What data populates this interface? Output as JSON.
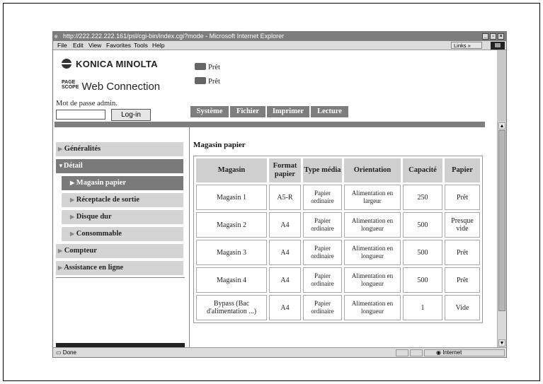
{
  "window": {
    "title": "http://222.222.222.161/psl/cgi-bin/index.cgi?mode - Microsoft Internet Explorer",
    "menu": [
      "File",
      "Edit",
      "View",
      "Favorites",
      "Tools",
      "Help"
    ],
    "links_label": "Links »",
    "status_text": "Done",
    "zone_text": "Internet"
  },
  "header": {
    "brand": "KONICA MINOLTA",
    "pagescope_small_1": "PAGE",
    "pagescope_small_2": "SCOPE",
    "pagescope_product": "Web Connection",
    "password_label": "Mot de passe admin.",
    "login_button": "Log-in",
    "status_1": "Prêt",
    "status_2": "Prêt"
  },
  "tabs": [
    "Système",
    "Fichier",
    "Imprimer",
    "Lecture"
  ],
  "sidebar": {
    "items": [
      {
        "label": "Généralités",
        "marker": "▶"
      },
      {
        "label": "Détail",
        "marker": "▼"
      },
      {
        "label": "Magasin papier",
        "marker": "▶"
      },
      {
        "label": "Réceptacle de sortie",
        "marker": "▶"
      },
      {
        "label": "Disque dur",
        "marker": "▶"
      },
      {
        "label": "Consommable",
        "marker": "▶"
      },
      {
        "label": "Compteur",
        "marker": "▶"
      },
      {
        "label": "Assistance en ligne",
        "marker": "▶"
      }
    ]
  },
  "main": {
    "title": "Magasin papier",
    "columns": [
      "Magasin",
      "Format papier",
      "Type média",
      "Orientation",
      "Capacité",
      "Papier"
    ],
    "rows": [
      [
        "Magasin 1",
        "A5-R",
        "Papier ordinaire",
        "Alimentation en largeur",
        "250",
        "Prêt"
      ],
      [
        "Magasin 2",
        "A4",
        "Papier ordinaire",
        "Alimentation en longueur",
        "500",
        "Presque vide"
      ],
      [
        "Magasin 3",
        "A4",
        "Papier ordinaire",
        "Alimentation en longueur",
        "500",
        "Prêt"
      ],
      [
        "Magasin 4",
        "A4",
        "Papier ordinaire",
        "Alimentation en longueur",
        "500",
        "Prêt"
      ],
      [
        "Bypass (Bac d'alimentation ...)",
        "A4",
        "Papier ordinaire",
        "Alimentation en longueur",
        "1",
        "Vide"
      ]
    ]
  }
}
